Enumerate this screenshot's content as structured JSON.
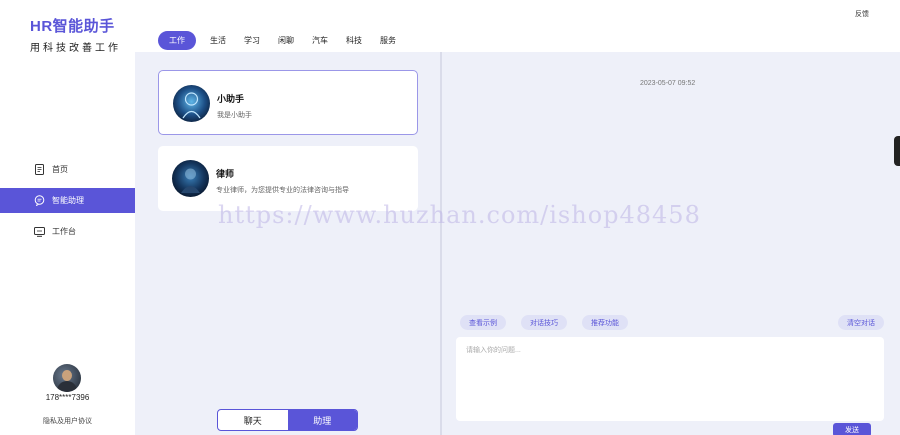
{
  "brand": {
    "title": "HR智能助手",
    "subtitle": "用科技改善工作"
  },
  "header": {
    "tabs": [
      {
        "label": "工作",
        "active": true
      },
      {
        "label": "生活"
      },
      {
        "label": "学习"
      },
      {
        "label": "闲聊"
      },
      {
        "label": "汽车"
      },
      {
        "label": "科技"
      },
      {
        "label": "服务"
      }
    ],
    "feedback": "反馈"
  },
  "sidebar": {
    "items": [
      {
        "label": "首页",
        "icon": "document-icon"
      },
      {
        "label": "智能助理",
        "icon": "chat-bubble-icon",
        "active": true
      },
      {
        "label": "工作台",
        "icon": "monitor-icon"
      }
    ],
    "phone": "178****7396",
    "privacy": "隐私及用户协议"
  },
  "assistants": [
    {
      "name": "小助手",
      "desc": "我是小助手",
      "selected": true
    },
    {
      "name": "律师",
      "desc": "专业律师，为您提供专业的法律咨询与指导"
    }
  ],
  "mode_toggle": {
    "chat": "聊天",
    "assistant": "助理",
    "active": "assistant"
  },
  "chat": {
    "timestamp": "2023-05-07 09:52",
    "pills": {
      "examples": "查看示例",
      "tips": "对话技巧",
      "recommend": "推荐功能",
      "clear": "清空对话"
    },
    "input_placeholder": "请输入你的问题...",
    "send": "发送"
  },
  "watermark": "https://www.huzhan.com/ishop48458",
  "colors": {
    "accent": "#5a55d8",
    "panel_bg": "#eef0f9",
    "pill_bg": "#dfe1f6"
  }
}
